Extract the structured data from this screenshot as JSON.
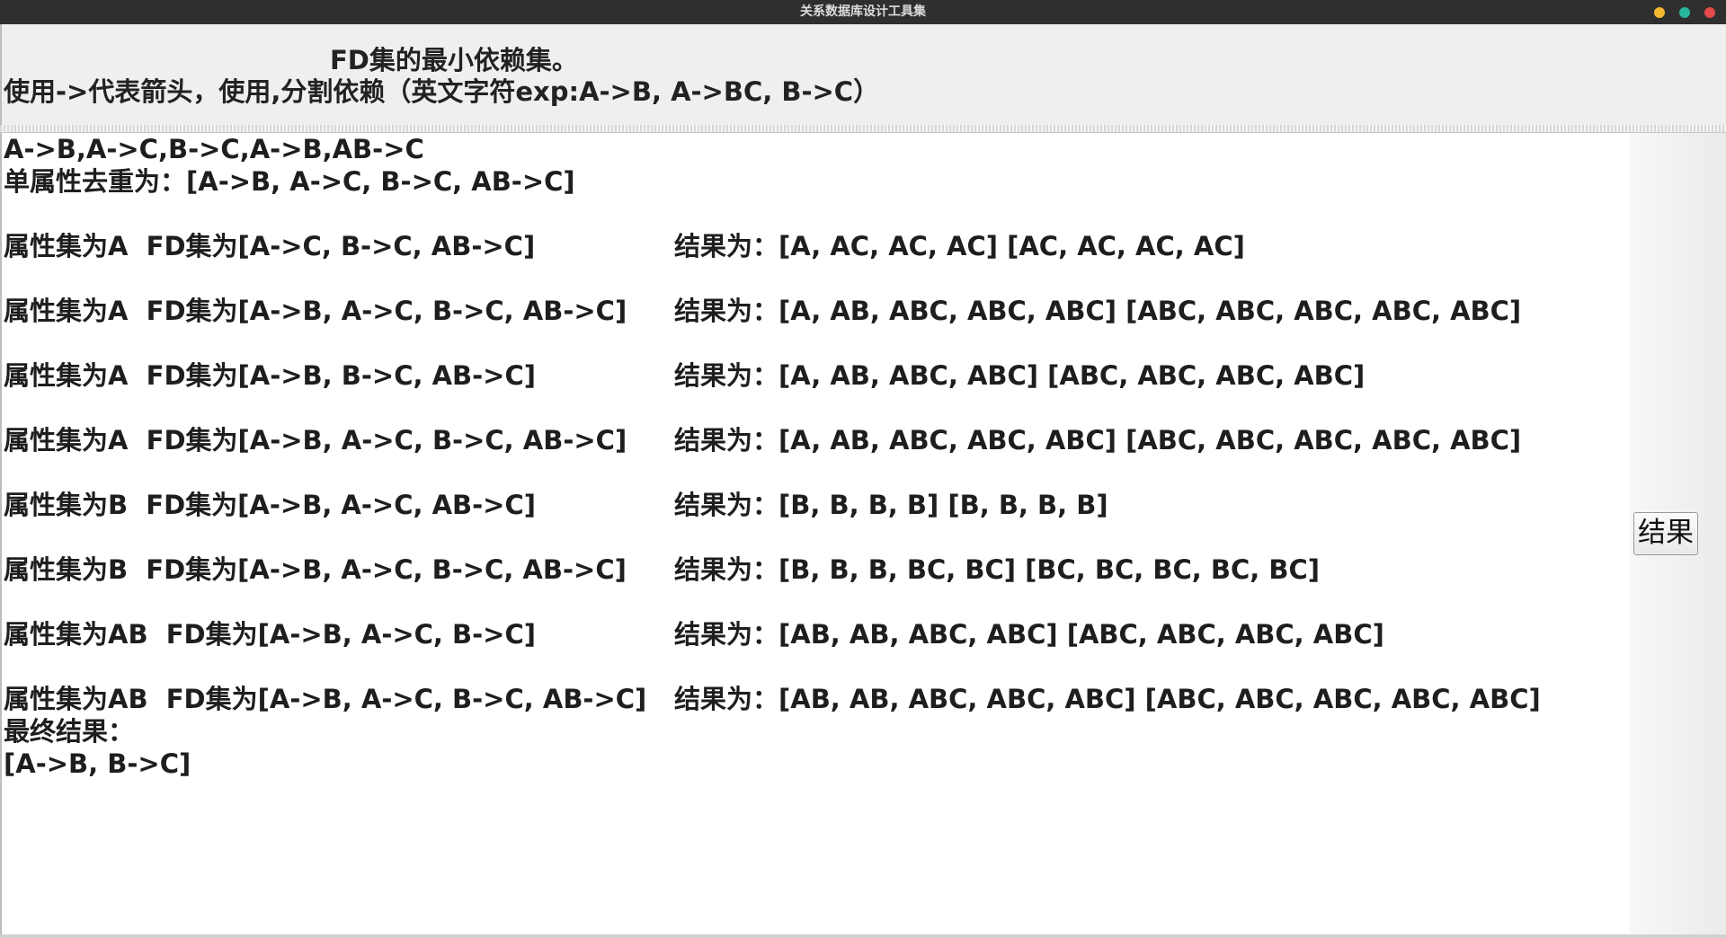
{
  "window": {
    "title": "关系数据库设计工具集",
    "buttons": [
      {
        "name": "minimize",
        "color": "#f5b82e"
      },
      {
        "name": "maximize",
        "color": "#25b69b"
      },
      {
        "name": "close",
        "color": "#e64a4a"
      }
    ]
  },
  "header": {
    "title": "FD集的最小依赖集。",
    "instructions": "使用->代表箭头，使用,分割依赖（英文字符exp:A->B, A->BC, B->C）"
  },
  "output": {
    "input_line": "A->B,A->C,B->C,A->B,AB->C",
    "dedup_line": "单属性去重为：[A->B, A->C, B->C, AB->C]",
    "steps": [
      {
        "left": "属性集为A  FD集为[A->C, B->C, AB->C]",
        "right": "结果为：[A, AC, AC, AC] [AC, AC, AC, AC]"
      },
      {
        "left": "属性集为A  FD集为[A->B, A->C, B->C, AB->C]",
        "right": "结果为：[A, AB, ABC, ABC, ABC] [ABC, ABC, ABC, ABC, ABC]"
      },
      {
        "left": "属性集为A  FD集为[A->B, B->C, AB->C]",
        "right": "结果为：[A, AB, ABC, ABC] [ABC, ABC, ABC, ABC]"
      },
      {
        "left": "属性集为A  FD集为[A->B, A->C, B->C, AB->C]",
        "right": "结果为：[A, AB, ABC, ABC, ABC] [ABC, ABC, ABC, ABC, ABC]"
      },
      {
        "left": "属性集为B  FD集为[A->B, A->C, AB->C]",
        "right": "结果为：[B, B, B, B] [B, B, B, B]"
      },
      {
        "left": "属性集为B  FD集为[A->B, A->C, B->C, AB->C]",
        "right": "结果为：[B, B, B, BC, BC] [BC, BC, BC, BC, BC]"
      },
      {
        "left": "属性集为AB  FD集为[A->B, A->C, B->C]",
        "right": "结果为：[AB, AB, ABC, ABC] [ABC, ABC, ABC, ABC]"
      },
      {
        "left": "属性集为AB  FD集为[A->B, A->C, B->C, AB->C]",
        "right": "结果为：[AB, AB, ABC, ABC, ABC] [ABC, ABC, ABC, ABC, ABC]"
      }
    ],
    "final_label": "最终结果：",
    "final_value": "[A->B, B->C]"
  },
  "sidebar": {
    "result_button_label": "结果"
  }
}
